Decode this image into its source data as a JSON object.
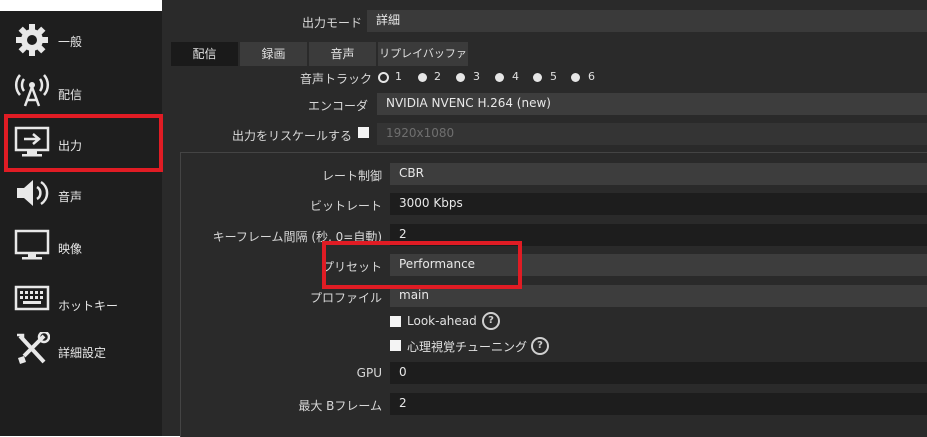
{
  "sidebar": {
    "items": [
      {
        "label": "一般",
        "icon": "gear-icon"
      },
      {
        "label": "配信",
        "icon": "broadcast-antenna-icon"
      },
      {
        "label": "出力",
        "icon": "output-monitor-icon"
      },
      {
        "label": "音声",
        "icon": "speaker-icon"
      },
      {
        "label": "映像",
        "icon": "monitor-icon"
      },
      {
        "label": "ホットキー",
        "icon": "keyboard-icon"
      },
      {
        "label": "詳細設定",
        "icon": "tools-icon"
      }
    ]
  },
  "output_mode": {
    "label": "出力モード",
    "value": "詳細"
  },
  "tabs": [
    "配信",
    "録画",
    "音声",
    "リプレイバッファ"
  ],
  "audio_track": {
    "label": "音声トラック",
    "options": [
      "1",
      "2",
      "3",
      "4",
      "5",
      "6"
    ],
    "selected": "1"
  },
  "encoder": {
    "label": "エンコーダ",
    "value": "NVIDIA NVENC H.264 (new)"
  },
  "rescale": {
    "label": "出力をリスケールする",
    "value": "1920x1080"
  },
  "rate_control": {
    "label": "レート制御",
    "value": "CBR"
  },
  "bitrate": {
    "label": "ビットレート",
    "value": "3000 Kbps"
  },
  "keyframe": {
    "label": "キーフレーム間隔 (秒, 0=自動)",
    "value": "2"
  },
  "preset": {
    "label": "プリセット",
    "value": "Performance"
  },
  "profile": {
    "label": "プロファイル",
    "value": "main"
  },
  "lookahead": {
    "label": "Look-ahead"
  },
  "psycho_visual": {
    "label": "心理視覚チューニング"
  },
  "gpu": {
    "label": "GPU",
    "value": "0"
  },
  "max_bframes": {
    "label": "最大 Bフレーム",
    "value": "2"
  },
  "help_icon_text": "?",
  "colors": {
    "highlight": "#e01c24",
    "sidebar_bg": "#1e1e1e",
    "panel_bg": "#2a2a2a"
  }
}
